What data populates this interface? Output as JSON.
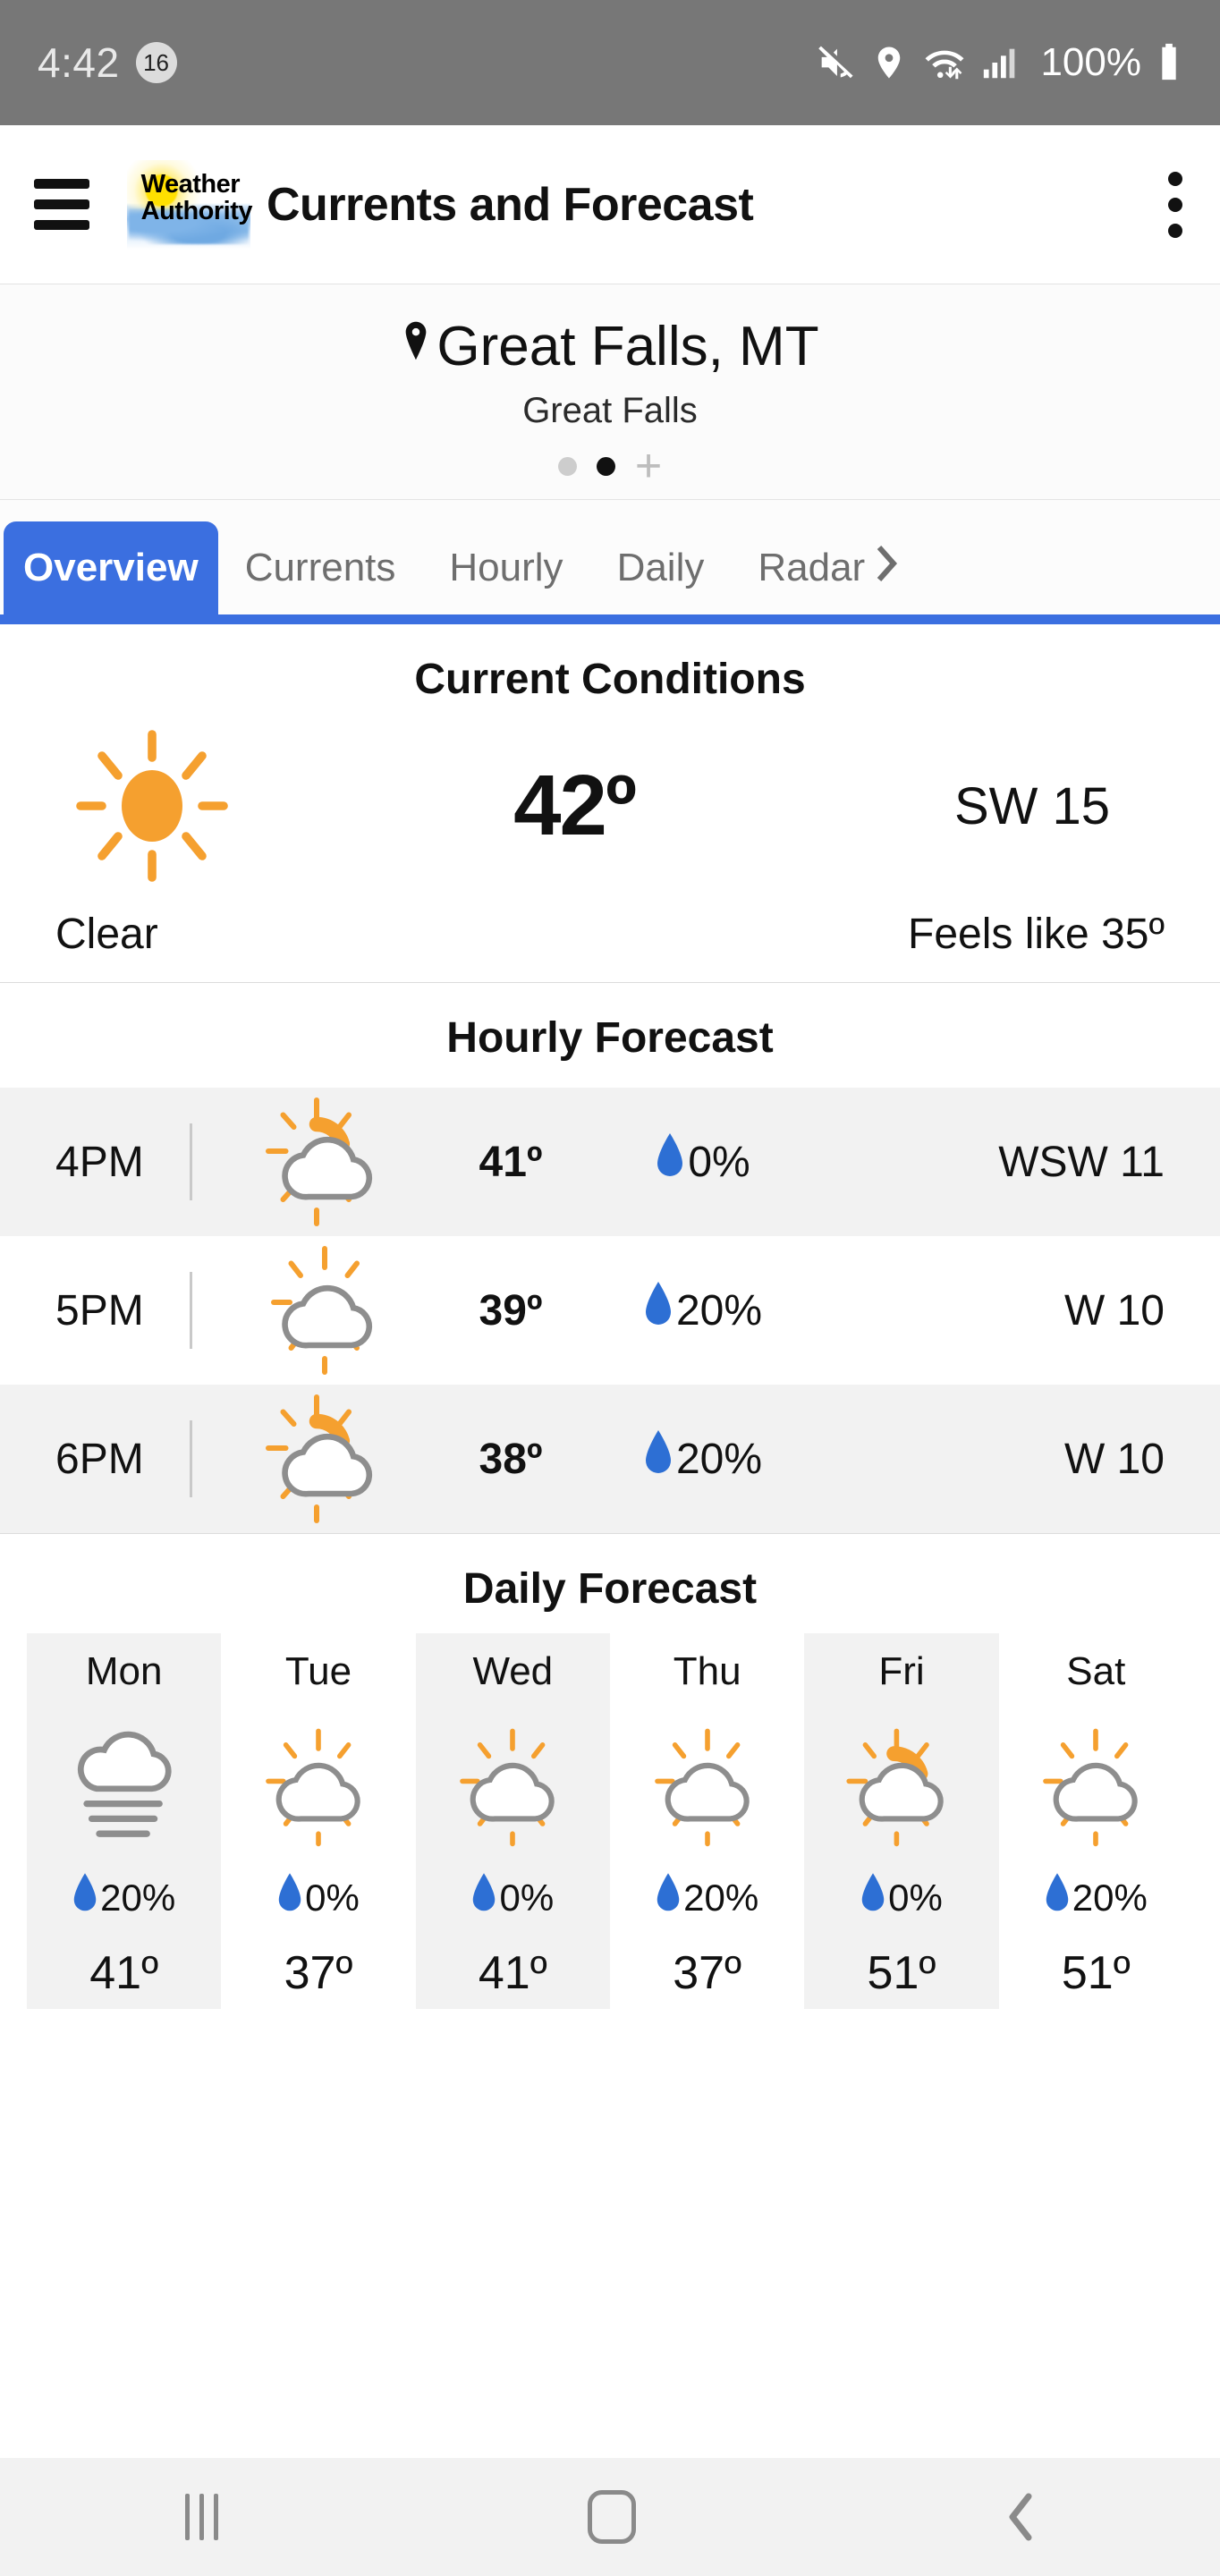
{
  "status_bar": {
    "time": "4:42",
    "notification_count": "16",
    "battery_percent": "100%",
    "icons": [
      "mute-icon",
      "location-icon",
      "wifi-icon",
      "signal-icon",
      "battery-icon"
    ]
  },
  "app_bar": {
    "menu_icon": "hamburger-menu-icon",
    "logo_line1": "Weather",
    "logo_line2": "Authority",
    "title": "Currents and Forecast",
    "overflow_icon": "kebab-menu-icon"
  },
  "location": {
    "pin_icon": "location-pin-icon",
    "city": "Great Falls, MT",
    "subtitle": "Great Falls",
    "add_label": "+",
    "page_dots": 2,
    "active_dot_index": 1
  },
  "tabs": [
    {
      "label": "Overview",
      "active": true
    },
    {
      "label": "Currents",
      "active": false
    },
    {
      "label": "Hourly",
      "active": false
    },
    {
      "label": "Daily",
      "active": false
    },
    {
      "label": "Radar",
      "active": false
    }
  ],
  "current_conditions": {
    "heading": "Current Conditions",
    "icon": "sun-icon",
    "temperature": "42º",
    "wind": "SW  15",
    "condition": "Clear",
    "feels_like": "Feels like 35º"
  },
  "hourly_forecast": {
    "heading": "Hourly Forecast",
    "rows": [
      {
        "time": "4PM",
        "icon": "partly-cloudy-icon",
        "temp": "41º",
        "pop": "0%",
        "wind": "WSW 11"
      },
      {
        "time": "5PM",
        "icon": "mostly-cloudy-icon",
        "temp": "39º",
        "pop": "20%",
        "wind": "W 10"
      },
      {
        "time": "6PM",
        "icon": "partly-cloudy-icon",
        "temp": "38º",
        "pop": "20%",
        "wind": "W 10"
      }
    ]
  },
  "daily_forecast": {
    "heading": "Daily Forecast",
    "days": [
      {
        "day": "Mon",
        "icon": "fog-icon",
        "pop": "20%",
        "temp": "41º"
      },
      {
        "day": "Tue",
        "icon": "mostly-cloudy-icon",
        "pop": "0%",
        "temp": "37º"
      },
      {
        "day": "Wed",
        "icon": "mostly-cloudy-icon",
        "pop": "0%",
        "temp": "41º"
      },
      {
        "day": "Thu",
        "icon": "mostly-cloudy-icon",
        "pop": "20%",
        "temp": "37º"
      },
      {
        "day": "Fri",
        "icon": "partly-cloudy-icon",
        "pop": "0%",
        "temp": "51º"
      },
      {
        "day": "Sat",
        "icon": "mostly-cloudy-icon",
        "pop": "20%",
        "temp": "51º"
      }
    ]
  },
  "nav_bar": {
    "recents_icon": "recents-icon",
    "home_icon": "home-icon",
    "back_icon": "back-icon"
  },
  "colors": {
    "accent_blue": "#3b6fe0",
    "sun_orange": "#f5a02f",
    "droplet_blue": "#2d6fd4",
    "statusbar_gray": "#777777",
    "row_alt_gray": "#f2f2f2"
  }
}
